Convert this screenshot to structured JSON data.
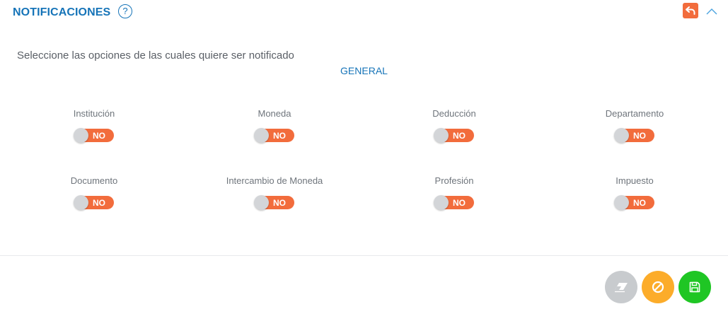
{
  "header": {
    "title": "NOTIFICACIONES",
    "help_glyph": "?",
    "help_icon": "question-circle-icon",
    "back_icon": "undo-arrow-icon",
    "collapse_icon": "chevron-up-icon"
  },
  "instructions": "Seleccione las opciones de las cuales quiere ser notificado",
  "section": {
    "label": "GENERAL"
  },
  "options": [
    {
      "label": "Institución",
      "state": "NO"
    },
    {
      "label": "Moneda",
      "state": "NO"
    },
    {
      "label": "Deducción",
      "state": "NO"
    },
    {
      "label": "Departamento",
      "state": "NO"
    },
    {
      "label": "Documento",
      "state": "NO"
    },
    {
      "label": "Intercambio de Moneda",
      "state": "NO"
    },
    {
      "label": "Profesión",
      "state": "NO"
    },
    {
      "label": "Impuesto",
      "state": "NO"
    }
  ],
  "actions": {
    "clear_icon": "eraser-icon",
    "cancel_icon": "ban-icon",
    "save_icon": "floppy-disk-icon"
  },
  "colors": {
    "accent": "#1674b8",
    "toggle_off": "#f26c3c",
    "clear": "#c8cbce",
    "cancel": "#fcac2a",
    "save": "#1fc624"
  }
}
